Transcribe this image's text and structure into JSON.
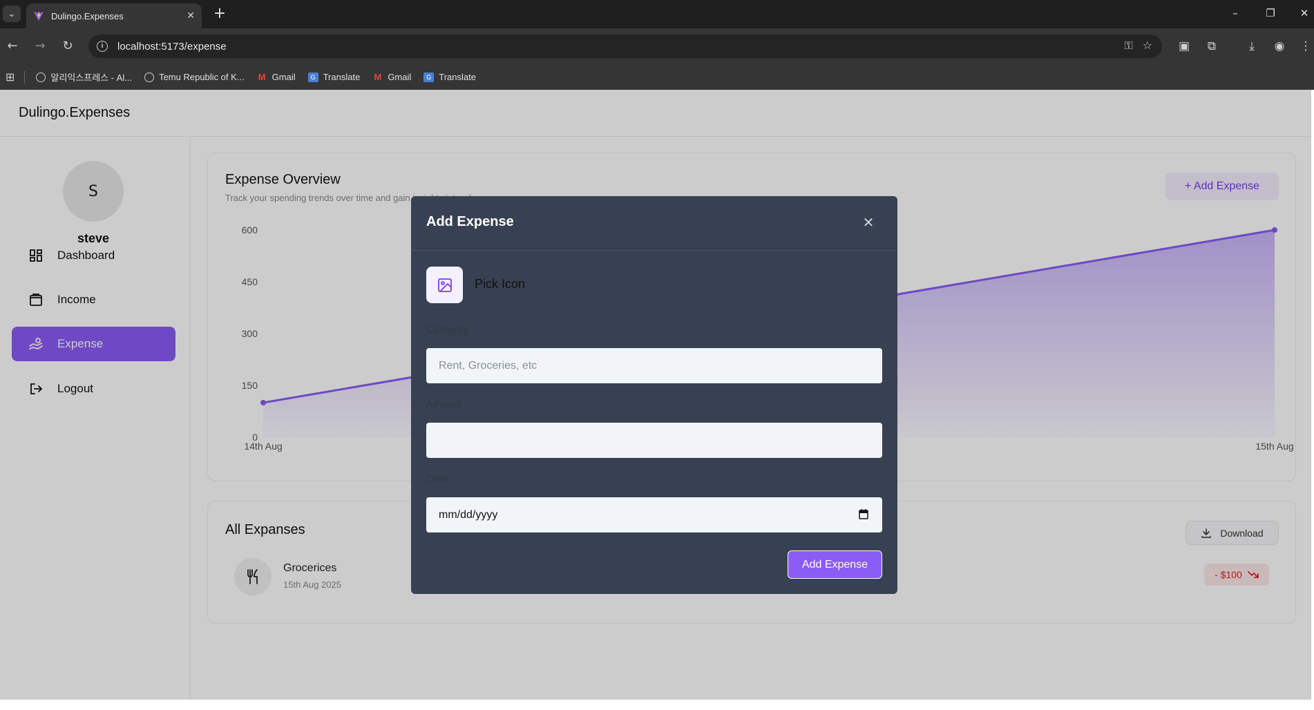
{
  "browser": {
    "tab_title": "Dulingo.Expenses",
    "url": "localhost:5173/expense",
    "bookmarks": [
      {
        "label": "알리익스프레스 - Al...",
        "icon": "globe-icon"
      },
      {
        "label": "Temu Republic of K...",
        "icon": "globe-icon"
      },
      {
        "label": "Gmail",
        "icon": "gmail-icon"
      },
      {
        "label": "Translate",
        "icon": "translate-icon"
      },
      {
        "label": "Gmail",
        "icon": "gmail-icon"
      },
      {
        "label": "Translate",
        "icon": "translate-icon"
      }
    ]
  },
  "app": {
    "brand": "Dulingo.Expenses",
    "user": {
      "initial": "S",
      "name": "steve"
    },
    "nav": [
      {
        "label": "Dashboard",
        "icon": "dashboard-icon",
        "active": false
      },
      {
        "label": "Income",
        "icon": "wallet-icon",
        "active": false
      },
      {
        "label": "Expense",
        "icon": "expense-hand-icon",
        "active": true
      },
      {
        "label": "Logout",
        "icon": "logout-icon",
        "active": false
      }
    ],
    "overview": {
      "title": "Expense Overview",
      "subtitle": "Track your spending trends over time and gain insights into where",
      "add_button": "+ Add Expense"
    },
    "all_expenses": {
      "title": "All Expanses",
      "download_label": "Download",
      "items": [
        {
          "name": "Grocerices",
          "date": "15th Aug 2025",
          "amount": "- $100",
          "icon": "utensils-icon"
        }
      ]
    }
  },
  "chart_data": {
    "type": "area",
    "x": [
      "14th Aug",
      "15th Aug"
    ],
    "series": [
      {
        "values": [
          100,
          600
        ]
      }
    ],
    "y_ticks": [
      0,
      150,
      300,
      450,
      600
    ],
    "ylim": [
      0,
      600
    ],
    "color": "#875cf5",
    "grid": false
  },
  "modal": {
    "title": "Add Expense",
    "pick_icon_label": "Pick Icon",
    "category_label": "Category",
    "category_placeholder": "Rent, Groceries, etc",
    "amount_label": "Amount",
    "amount_value": "",
    "date_label": "Date",
    "date_placeholder": "mm/dd/yyyy",
    "submit_label": "Add Expense"
  },
  "colors": {
    "accent": "#8b5cf6",
    "modal_bg": "#374151",
    "danger": "#dc2626"
  }
}
